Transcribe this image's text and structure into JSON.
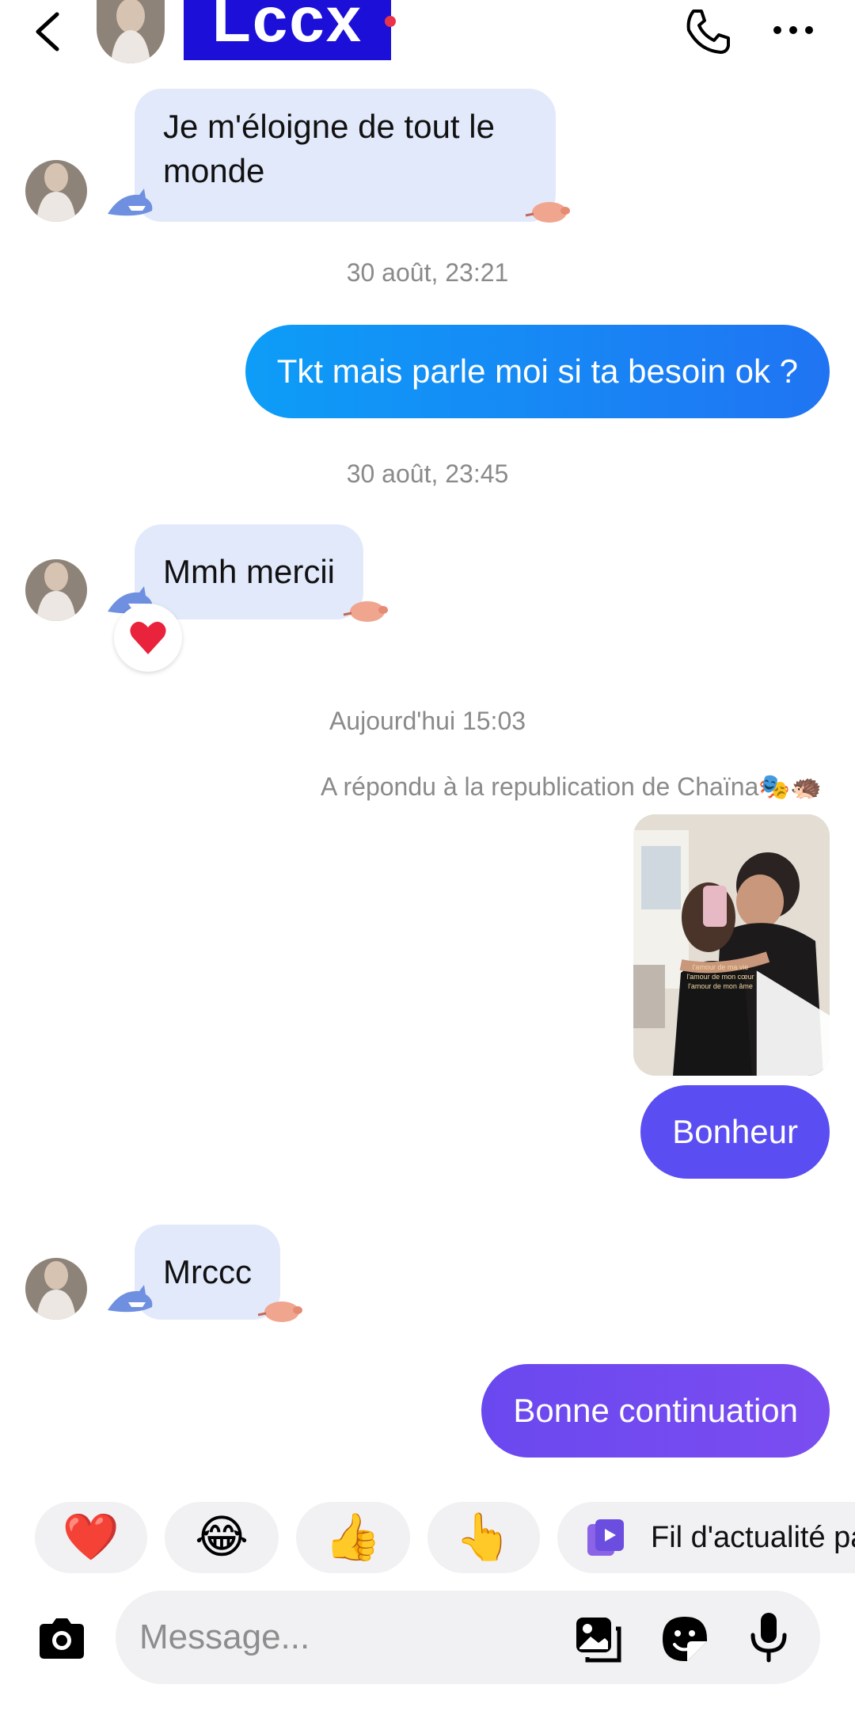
{
  "header": {
    "contact_name": "Lccx",
    "back_icon": "chevron-left-icon",
    "call_icon": "phone-icon",
    "more_icon": "more-horizontal-icon"
  },
  "messages": [
    {
      "type": "incoming",
      "text": "Je m'éloigne de tout le monde"
    },
    {
      "type": "timestamp",
      "text": "30 août, 23:21"
    },
    {
      "type": "outgoing",
      "text": "Tkt mais parle moi si ta besoin ok ?"
    },
    {
      "type": "timestamp",
      "text": "30 août, 23:45"
    },
    {
      "type": "incoming",
      "text": "Mmh mercii",
      "reaction": "❤️"
    },
    {
      "type": "timestamp",
      "text": "Aujourd'hui 15:03"
    },
    {
      "type": "reply_note",
      "text": "A répondu à la republication de Chaïna🎭🦔"
    },
    {
      "type": "video",
      "overlay_text": "l'amour de ma vie\nl'amour de mon cœur\nl'amour de mon âme"
    },
    {
      "type": "outgoing",
      "text": "Bonheur"
    },
    {
      "type": "incoming",
      "text": "Mrccc"
    },
    {
      "type": "outgoing",
      "text": "Bonne continuation"
    }
  ],
  "quick_replies": [
    "❤️",
    "😂",
    "👍",
    "👆"
  ],
  "feed_chip_label": "Fil d'actualité pa",
  "composer": {
    "placeholder": "Message..."
  },
  "colors": {
    "incoming_bubble": "#e2e9fb",
    "outgoing_blue": "#1a8cf2",
    "outgoing_purple": "#6a4bf0",
    "header_name_bg": "#1c10d8"
  }
}
